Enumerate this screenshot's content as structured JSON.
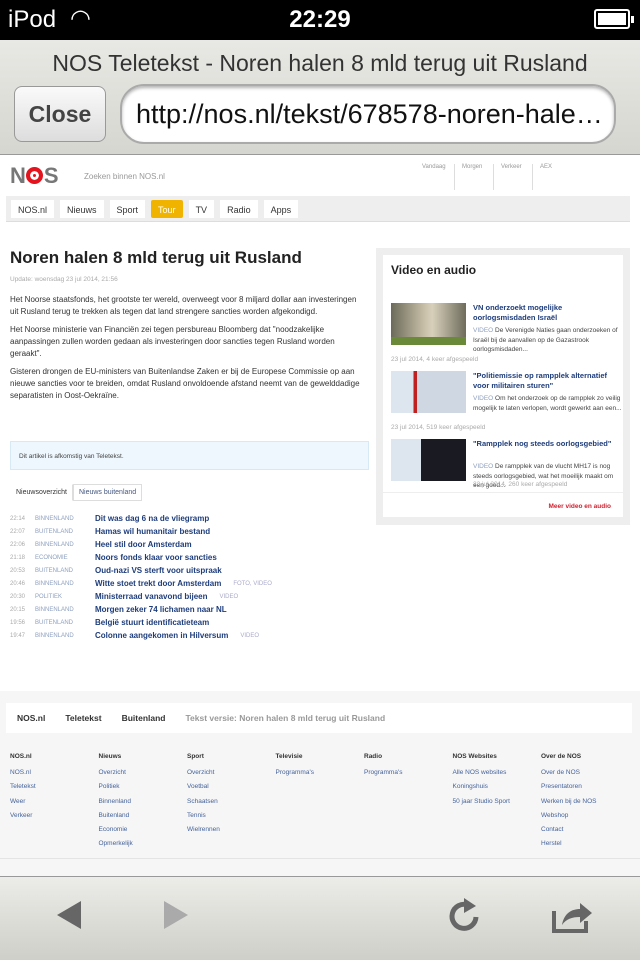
{
  "status_bar": {
    "carrier": "iPod",
    "time": "22:29"
  },
  "browser": {
    "title": "NOS Teletekst - Noren halen 8 mld terug uit Rusland",
    "close_label": "Close",
    "url": "http://nos.nl/tekst/678578-noren-halen-8-mld-terug-uit-rusland.html"
  },
  "header": {
    "logo": "NOS",
    "search_placeholder": "Zoeken binnen NOS.nl",
    "top_links": [
      "Vandaag",
      "Morgen",
      "Verkeer",
      "AEX"
    ],
    "nav": [
      "NOS.nl",
      "Nieuws",
      "Sport",
      "Tour",
      "TV",
      "Radio",
      "Apps"
    ],
    "active_nav": "Tour",
    "accent": "#f0b400"
  },
  "article": {
    "title": "Noren halen 8 mld terug uit Rusland",
    "update": "Update: woensdag 23 jul 2014, 21:56",
    "paragraphs": [
      "Het Noorse staatsfonds, het grootste ter wereld, overweegt voor 8 miljard dollar aan investeringen uit Rusland terug te trekken als tegen dat land strengere sancties worden afgekondigd.",
      "Het Noorse ministerie van Financiën zei tegen persbureau Bloomberg dat \"noodzakelijke aanpassingen zullen worden gedaan als investeringen door sancties tegen Rusland worden geraakt\".",
      "Gisteren drongen de EU-ministers van Buitenlandse Zaken er bij de Europese Commissie op aan nieuwe sancties voor te breiden, omdat Rusland onvoldoende afstand neemt van de gewelddadige separatisten in Oost-Oekraïne."
    ],
    "note": "Dit artikel is afkomstig van Teletekst."
  },
  "news_tabs": [
    "Nieuwsoverzicht",
    "Nieuws buitenland"
  ],
  "news": [
    {
      "time": "22:14",
      "cat": "BINNENLAND",
      "title": "Dit was dag 6 na de vliegramp",
      "extra": ""
    },
    {
      "time": "22:07",
      "cat": "BUITENLAND",
      "title": "Hamas wil humanitair bestand",
      "extra": ""
    },
    {
      "time": "22:06",
      "cat": "BINNENLAND",
      "title": "Heel stil door Amsterdam",
      "extra": ""
    },
    {
      "time": "21:18",
      "cat": "ECONOMIE",
      "title": "Noors fonds klaar voor sancties",
      "extra": ""
    },
    {
      "time": "20:53",
      "cat": "BUITENLAND",
      "title": "Oud-nazi VS sterft voor uitspraak",
      "extra": ""
    },
    {
      "time": "20:46",
      "cat": "BINNENLAND",
      "title": "Witte stoet trekt door Amsterdam",
      "extra": "FOTO, VIDEO"
    },
    {
      "time": "20:30",
      "cat": "POLITIEK",
      "title": "Ministerraad vanavond bijeen",
      "extra": "VIDEO"
    },
    {
      "time": "20:15",
      "cat": "BINNENLAND",
      "title": "Morgen zeker 74 lichamen naar NL",
      "extra": ""
    },
    {
      "time": "19:56",
      "cat": "BUITENLAND",
      "title": "België stuurt identificatieteam",
      "extra": ""
    },
    {
      "time": "19:47",
      "cat": "BINNENLAND",
      "title": "Colonne aangekomen in Hilversum",
      "extra": "VIDEO"
    }
  ],
  "video": {
    "title": "Video en audio",
    "more": "Meer video en audio",
    "items": [
      {
        "title": "VN onderzoekt mogelijke oorlogsmisdaden Israël",
        "tag": "VIDEO",
        "desc": " De Verenigde Naties gaan onderzoeken of Israël bij de aanvallen op de Gazastrook oorlogsmisdaden...",
        "meta": "23 jul 2014, 4 keer afgespeeld"
      },
      {
        "title": "\"Politiemissie op rampplek alternatief voor militairen sturen\"",
        "tag": "VIDEO",
        "desc": " Om het onderzoek op de rampplek zo veilig mogelijk te laten verlopen, wordt gewerkt aan een...",
        "meta": "23 jul 2014, 519 keer afgespeeld"
      },
      {
        "title": "\"Rampplek nog steeds oorlogsgebied\"",
        "tag": "VIDEO",
        "desc": " De rampplek van de vlucht MH17 is nog steeds oorlogsgebied, wat het moeilijk maakt om een goed...",
        "meta": "23 jul 2014, 260 keer afgespeeld"
      }
    ]
  },
  "footer": {
    "bar": [
      "NOS.nl",
      "Teletekst",
      "Buitenland"
    ],
    "bar_text": "Tekst versie: Noren halen 8 mld terug uit Rusland",
    "columns": [
      {
        "head": "NOS.nl",
        "links": [
          "NOS.nl",
          "Teletekst",
          "Weer",
          "Verkeer"
        ]
      },
      {
        "head": "Nieuws",
        "links": [
          "Overzicht",
          "Politiek",
          "Binnenland",
          "Buitenland",
          "Economie",
          "Opmerkelijk"
        ]
      },
      {
        "head": "Sport",
        "links": [
          "Overzicht",
          "Voetbal",
          "Schaatsen",
          "Tennis",
          "Wielrennen"
        ]
      },
      {
        "head": "Televisie",
        "links": [
          "Programma's"
        ]
      },
      {
        "head": "Radio",
        "links": [
          "Programma's"
        ]
      },
      {
        "head": "NOS Websites",
        "links": [
          "Alle NOS websites",
          "Koningshuis",
          "50 jaar Studio Sport"
        ]
      },
      {
        "head": "Over de NOS",
        "links": [
          "Over de NOS",
          "Presentatoren",
          "Werken bij de NOS",
          "Webshop",
          "Contact",
          "Herstel"
        ]
      }
    ]
  }
}
